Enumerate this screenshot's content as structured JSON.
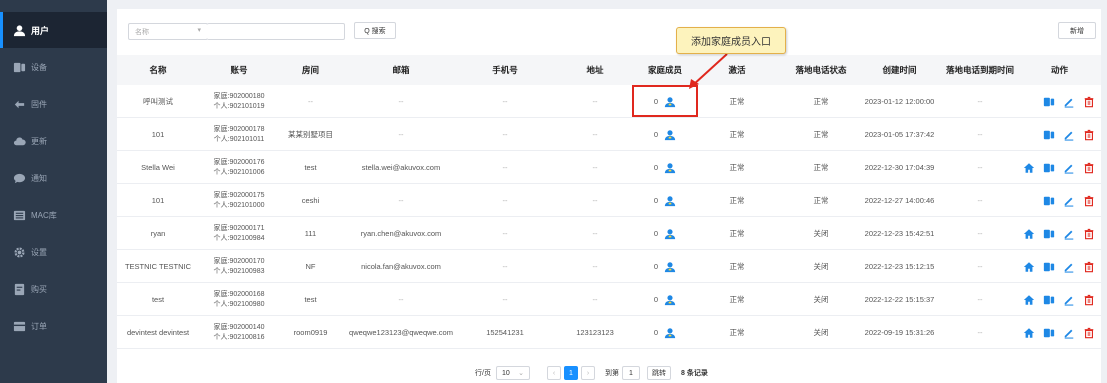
{
  "sidebar": {
    "items": [
      {
        "label": "用户",
        "icon": "user-icon",
        "active": true
      },
      {
        "label": "设备",
        "icon": "device-icon"
      },
      {
        "label": "固件",
        "icon": "firmware-icon"
      },
      {
        "label": "更新",
        "icon": "cloud-update-icon"
      },
      {
        "label": "通知",
        "icon": "chat-icon"
      },
      {
        "label": "MAC库",
        "icon": "list-icon"
      },
      {
        "label": "设置",
        "icon": "gear-icon"
      },
      {
        "label": "购买",
        "icon": "purchase-icon"
      },
      {
        "label": "订单",
        "icon": "order-icon"
      }
    ]
  },
  "toolbar": {
    "filter_placeholder": "名称",
    "search_value": "",
    "search_label": "Q 搜索",
    "add_label": "新增"
  },
  "table": {
    "headers": [
      "名称",
      "账号",
      "房间",
      "邮箱",
      "手机号",
      "地址",
      "家庭成员",
      "激活",
      "落地电话状态",
      "创建时间",
      "落地电话到期时间",
      "动作"
    ],
    "rows": [
      {
        "name": "呼叫测试",
        "family": "家庭:902000180",
        "personal": "个人:902101019",
        "room": "--",
        "email": "--",
        "phone": "--",
        "address": "--",
        "members": "0",
        "active": "正常",
        "landline": "正常",
        "created": "2023-01-12 12:00:00",
        "expiry": "--",
        "actions": [
          "device",
          "edit",
          "delete"
        ]
      },
      {
        "name": "101",
        "family": "家庭:902000178",
        "personal": "个人:902101011",
        "room": "某某别墅项目",
        "email": "--",
        "phone": "--",
        "address": "--",
        "members": "0",
        "active": "正常",
        "landline": "正常",
        "created": "2023-01-05 17:37:42",
        "expiry": "--",
        "actions": [
          "device",
          "edit",
          "delete"
        ]
      },
      {
        "name": "Stella Wei",
        "family": "家庭:902000176",
        "personal": "个人:902101006",
        "room": "test",
        "email": "stella.wei@akuvox.com",
        "phone": "--",
        "address": "--",
        "members": "0",
        "active": "正常",
        "landline": "正常",
        "created": "2022-12-30 17:04:39",
        "expiry": "--",
        "actions": [
          "home",
          "device",
          "edit",
          "delete"
        ]
      },
      {
        "name": "101",
        "family": "家庭:902000175",
        "personal": "个人:902101000",
        "room": "ceshi",
        "email": "--",
        "phone": "--",
        "address": "--",
        "members": "0",
        "active": "正常",
        "landline": "正常",
        "created": "2022-12-27 14:00:46",
        "expiry": "--",
        "actions": [
          "device",
          "edit",
          "delete"
        ]
      },
      {
        "name": "ryan",
        "family": "家庭:902000171",
        "personal": "个人:902100984",
        "room": "111",
        "email": "ryan.chen@akuvox.com",
        "phone": "--",
        "address": "--",
        "members": "0",
        "active": "正常",
        "landline": "关闭",
        "created": "2022-12-23 15:42:51",
        "expiry": "--",
        "actions": [
          "home",
          "device",
          "edit",
          "delete"
        ]
      },
      {
        "name": "TESTNIC TESTNIC",
        "family": "家庭:902000170",
        "personal": "个人:902100983",
        "room": "NF",
        "email": "nicola.fan@akuvox.com",
        "phone": "--",
        "address": "--",
        "members": "0",
        "active": "正常",
        "landline": "关闭",
        "created": "2022-12-23 15:12:15",
        "expiry": "--",
        "actions": [
          "home",
          "device",
          "edit",
          "delete"
        ]
      },
      {
        "name": "test",
        "family": "家庭:902000168",
        "personal": "个人:902100980",
        "room": "test",
        "email": "--",
        "phone": "--",
        "address": "--",
        "members": "0",
        "active": "正常",
        "landline": "关闭",
        "created": "2022-12-22 15:15:37",
        "expiry": "--",
        "actions": [
          "home",
          "device",
          "edit",
          "delete"
        ]
      },
      {
        "name": "devintest devintest",
        "family": "家庭:902000140",
        "personal": "个人:902100816",
        "room": "room0919",
        "email": "qweqwe123123@qweqwe.com",
        "phone": "152541231",
        "address": "123123123",
        "members": "0",
        "active": "正常",
        "landline": "关闭",
        "created": "2022-09-19 15:31:26",
        "expiry": "--",
        "actions": [
          "home",
          "device",
          "edit",
          "delete"
        ]
      }
    ]
  },
  "annotation": {
    "callout_text": "添加家庭成员入口"
  },
  "pagination": {
    "per_page_label": "行/页",
    "per_page": "10",
    "current_page": "1",
    "goto_label": "到第",
    "goto_value": "1",
    "jump_label": "跳转",
    "total": "8 条记录"
  },
  "colors": {
    "sidebar_bg": "#2d3a4b",
    "accent": "#1890ff",
    "member_icon": "#1e88e5",
    "delete_icon": "#e0281e",
    "callout_bg": "#fdf3bd",
    "highlight": "#e0281e"
  }
}
